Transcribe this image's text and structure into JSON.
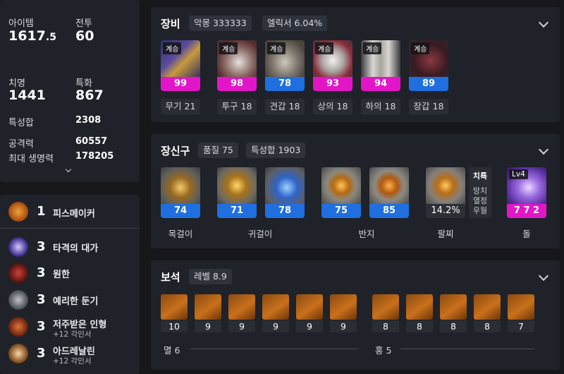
{
  "stats": {
    "item_label": "아이템",
    "item_value_main": "1617",
    "item_value_frac": ".5",
    "combat_label": "전투",
    "combat_value": "60",
    "crit_label": "치명",
    "crit_value": "1441",
    "spec_label": "특화",
    "spec_value": "867",
    "stat_sum_label": "특성합",
    "stat_sum_value": "2308",
    "attack_label": "공격력",
    "attack_value": "60557",
    "hp_label": "최대 생명력",
    "hp_value": "178205"
  },
  "engravings": [
    {
      "level": "1",
      "name": "피스메이커",
      "sub": "",
      "icon": "peacemaker-icon"
    },
    {
      "level": "3",
      "name": "타격의 대가",
      "sub": "",
      "icon": "master-brawler-icon"
    },
    {
      "level": "3",
      "name": "원한",
      "sub": "",
      "icon": "grudge-icon"
    },
    {
      "level": "3",
      "name": "예리한 둔기",
      "sub": "",
      "icon": "keen-blunt-icon"
    },
    {
      "level": "3",
      "name": "저주받은 인형",
      "sub": "+12 각인서",
      "icon": "cursed-doll-icon"
    },
    {
      "level": "3",
      "name": "아드레날린",
      "sub": "+12 각인서",
      "icon": "adrenaline-icon"
    }
  ],
  "equipment": {
    "title": "장비",
    "chip1": "악몽 333333",
    "chip2": "엘릭서 6.04%",
    "badge": "계승",
    "items": [
      {
        "quality": "99",
        "label": "무기 21",
        "bar_color": "#e216c8"
      },
      {
        "quality": "98",
        "label": "투구 18",
        "bar_color": "#e216c8"
      },
      {
        "quality": "78",
        "label": "견갑 18",
        "bar_color": "#1f6fe0"
      },
      {
        "quality": "93",
        "label": "상의 18",
        "bar_color": "#e216c8"
      },
      {
        "quality": "94",
        "label": "하의 18",
        "bar_color": "#e216c8"
      },
      {
        "quality": "89",
        "label": "장갑 18",
        "bar_color": "#1f6fe0"
      }
    ]
  },
  "accessories": {
    "title": "장신구",
    "chip1": "품질 75",
    "chip2": "특성합 1903",
    "items": [
      {
        "quality": "74"
      },
      {
        "quality": "71"
      },
      {
        "quality": "78"
      },
      {
        "quality": "75"
      },
      {
        "quality": "85"
      }
    ],
    "labels": {
      "necklace": "목걸이",
      "earring": "귀걸이",
      "ring": "반지",
      "bracelet": "팔찌",
      "stone": "돌"
    },
    "bracelet": {
      "value": "14.2%",
      "effects": [
        "치특",
        "망치",
        "열정",
        "우월"
      ]
    },
    "stone": {
      "badge": "Lv4",
      "value": "7 7 2"
    }
  },
  "gems": {
    "title": "보석",
    "chip": "레벨 8.9",
    "left": [
      "10",
      "9",
      "9",
      "9",
      "9",
      "9"
    ],
    "right": [
      "8",
      "8",
      "8",
      "8",
      "7"
    ],
    "left_label": "멸 6",
    "right_label": "홍 5"
  },
  "colors": {
    "pink": "#e216c8",
    "blue": "#1f6fe0",
    "panel": "#1f2228",
    "bg": "#15171b"
  }
}
